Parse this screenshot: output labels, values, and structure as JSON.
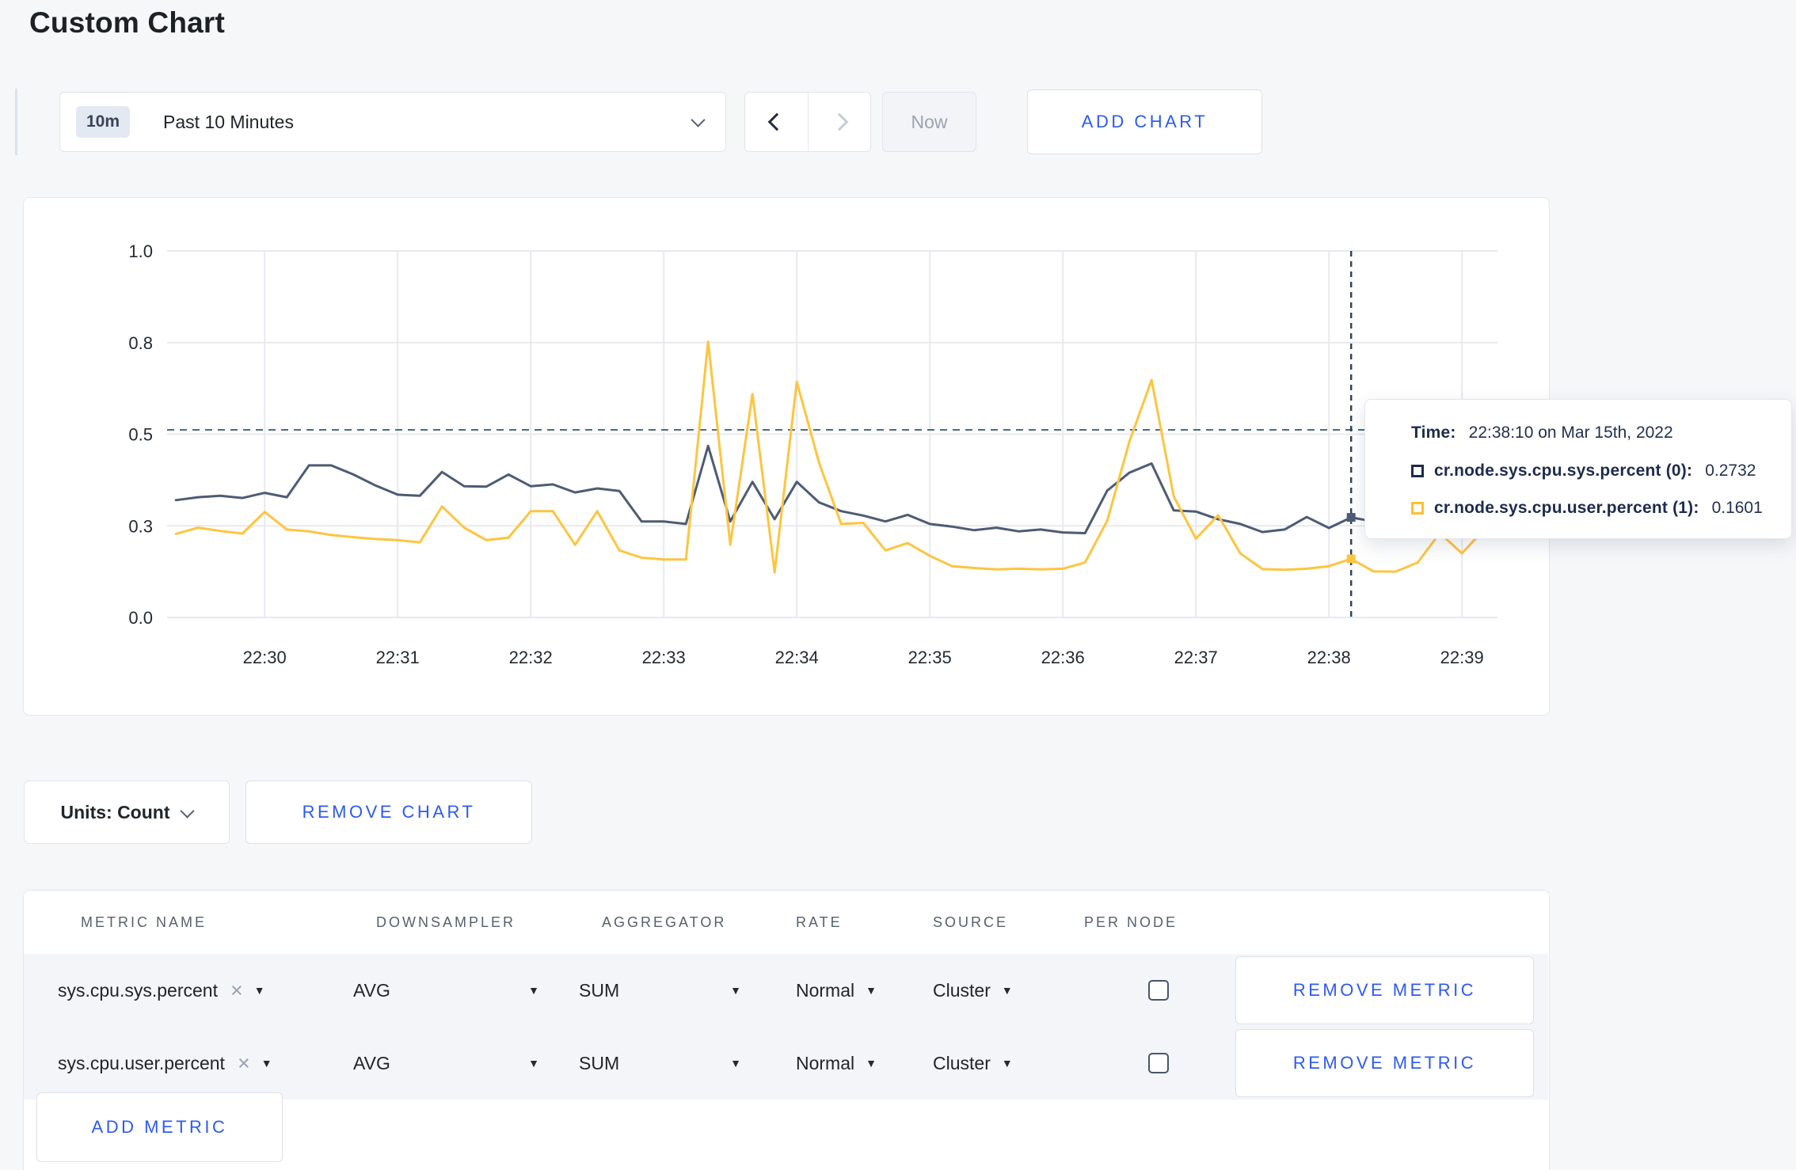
{
  "page": {
    "title": "Custom Chart"
  },
  "toolbar": {
    "time_badge": "10m",
    "time_label": "Past 10 Minutes",
    "now_label": "Now",
    "add_chart_label": "ADD CHART"
  },
  "tooltip": {
    "time_label": "Time:",
    "time_value": "22:38:10 on Mar 15th, 2022",
    "series": [
      {
        "label": "cr.node.sys.cpu.sys.percent (0):",
        "value": "0.2732",
        "color": "#1d2b4d"
      },
      {
        "label": "cr.node.sys.cpu.user.percent (1):",
        "value": "0.1601",
        "color": "#ffc02c"
      }
    ]
  },
  "units_row": {
    "units_label": "Units: Count",
    "remove_chart_label": "REMOVE CHART"
  },
  "metrics_table": {
    "headers": [
      "METRIC NAME",
      "DOWNSAMPLER",
      "AGGREGATOR",
      "RATE",
      "SOURCE",
      "PER NODE"
    ],
    "rows": [
      {
        "metric": "sys.cpu.sys.percent",
        "downsampler": "AVG",
        "aggregator": "SUM",
        "rate": "Normal",
        "source": "Cluster",
        "per_node_checked": false,
        "remove_label": "REMOVE METRIC"
      },
      {
        "metric": "sys.cpu.user.percent",
        "downsampler": "AVG",
        "aggregator": "SUM",
        "rate": "Normal",
        "source": "Cluster",
        "per_node_checked": false,
        "remove_label": "REMOVE METRIC"
      }
    ],
    "add_metric_label": "ADD METRIC"
  },
  "chart_data": {
    "type": "line",
    "title": "",
    "xlabel": "",
    "ylabel": "",
    "grid": true,
    "legend_position": "none (values shown in hover tooltip)",
    "y_lim": [
      0,
      1
    ],
    "y_gridlines": [
      {
        "v": 0,
        "label": "0.0"
      },
      {
        "v": 0.25,
        "label": "0.3"
      },
      {
        "v": 0.5,
        "label": "0.5"
      },
      {
        "v": 0.75,
        "label": "0.8"
      },
      {
        "v": 1,
        "label": "1.0"
      }
    ],
    "x_domain_seconds": [
      1756,
      2356
    ],
    "x_ticks": [
      {
        "t": 1800,
        "label": "22:30"
      },
      {
        "t": 1860,
        "label": "22:31"
      },
      {
        "t": 1920,
        "label": "22:32"
      },
      {
        "t": 1980,
        "label": "22:33"
      },
      {
        "t": 2040,
        "label": "22:34"
      },
      {
        "t": 2100,
        "label": "22:35"
      },
      {
        "t": 2160,
        "label": "22:36"
      },
      {
        "t": 2220,
        "label": "22:37"
      },
      {
        "t": 2280,
        "label": "22:38"
      },
      {
        "t": 2340,
        "label": "22:39"
      }
    ],
    "sampling": {
      "start_t_seconds": 1760,
      "interval_seconds": 10,
      "start_time": "22:29:20",
      "end_time": "22:39:10"
    },
    "reference_line": {
      "v": 0.512,
      "style": "dashed",
      "color": "#4a6b80"
    },
    "crosshair": {
      "t": 2290,
      "time": "22:38:10",
      "color": "#31415f",
      "points": [
        {
          "series": 0,
          "v": 0.273
        },
        {
          "series": 1,
          "v": 0.16
        }
      ]
    },
    "colors": {
      "grid": "#e7e9ee",
      "axis_text": "#242a31"
    },
    "series": [
      {
        "name": "cr.node.sys.cpu.sys.percent",
        "color": "#4e5b74",
        "values": [
          0.32,
          0.328,
          0.332,
          0.326,
          0.34,
          0.328,
          0.415,
          0.415,
          0.39,
          0.36,
          0.335,
          0.332,
          0.397,
          0.358,
          0.357,
          0.39,
          0.358,
          0.363,
          0.341,
          0.352,
          0.345,
          0.262,
          0.262,
          0.255,
          0.468,
          0.262,
          0.37,
          0.268,
          0.37,
          0.314,
          0.29,
          0.278,
          0.262,
          0.28,
          0.255,
          0.248,
          0.238,
          0.245,
          0.235,
          0.24,
          0.232,
          0.23,
          0.346,
          0.395,
          0.42,
          0.292,
          0.289,
          0.268,
          0.255,
          0.233,
          0.24,
          0.274,
          0.244,
          0.273,
          0.262,
          0.268,
          0.262,
          0.27,
          0.266,
          0.272
        ]
      },
      {
        "name": "cr.node.sys.cpu.user.percent",
        "color": "#fdc53f",
        "values": [
          0.228,
          0.245,
          0.236,
          0.229,
          0.288,
          0.24,
          0.235,
          0.225,
          0.219,
          0.214,
          0.211,
          0.205,
          0.303,
          0.245,
          0.211,
          0.218,
          0.29,
          0.29,
          0.198,
          0.29,
          0.183,
          0.163,
          0.158,
          0.158,
          0.752,
          0.198,
          0.61,
          0.123,
          0.643,
          0.423,
          0.255,
          0.258,
          0.183,
          0.203,
          0.168,
          0.14,
          0.135,
          0.131,
          0.133,
          0.131,
          0.133,
          0.15,
          0.264,
          0.48,
          0.648,
          0.33,
          0.215,
          0.279,
          0.175,
          0.132,
          0.13,
          0.133,
          0.14,
          0.16,
          0.126,
          0.125,
          0.15,
          0.23,
          0.175,
          0.24
        ]
      }
    ]
  }
}
